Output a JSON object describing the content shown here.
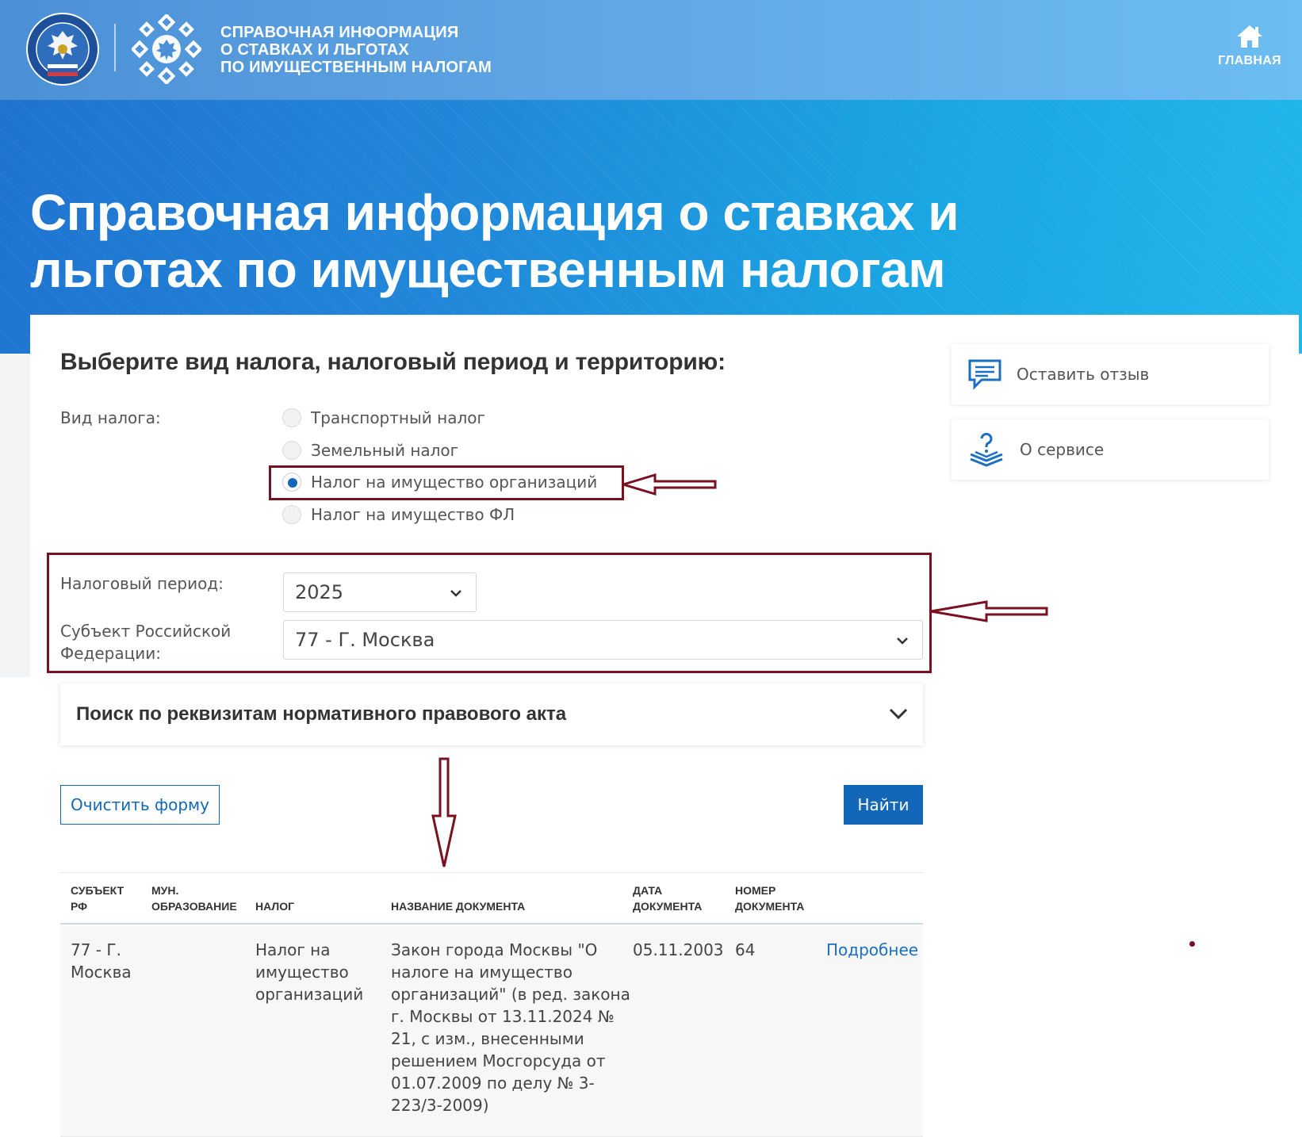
{
  "header": {
    "title_lines": [
      "Справочная информация",
      "о ставках и льготах",
      "по имущественным налогам"
    ],
    "home_label": "ГЛАВНАЯ",
    "icons": {
      "fns_logo": "fns-emblem-icon",
      "service_logo": "service-emblem-icon",
      "home": "home-icon"
    }
  },
  "hero": {
    "title": "Справочная информация о ставках и льготах по имущественным налогам"
  },
  "form": {
    "heading": "Выберите вид налога, налоговый период и территорию:",
    "tax_type_label": "Вид налога:",
    "tax_options": [
      {
        "label": "Транспортный налог",
        "selected": false
      },
      {
        "label": "Земельный налог",
        "selected": false
      },
      {
        "label": "Налог на имущество организаций",
        "selected": true
      },
      {
        "label": "Налог на имущество ФЛ",
        "selected": false
      }
    ],
    "period_label": "Налоговый период:",
    "period_value": "2025",
    "subject_label_line1": "Субъект Российской",
    "subject_label_line2": "Федерации:",
    "subject_value": "77 - Г. Москва",
    "accordion_title": "Поиск по реквизитам нормативного правового акта",
    "clear_button": "Очистить форму",
    "find_button": "Найти"
  },
  "side": {
    "feedback_label": "Оставить отзыв",
    "about_label": "О сервисе"
  },
  "table": {
    "headers": [
      [
        "СУБЪЕКТ",
        "РФ"
      ],
      [
        "МУН.",
        "ОБРАЗОВАНИЕ"
      ],
      [
        "",
        "НАЛОГ"
      ],
      [
        "",
        "НАЗВАНИЕ ДОКУМЕНТА"
      ],
      [
        "ДАТА",
        "ДОКУМЕНТА"
      ],
      [
        "НОМЕР",
        "ДОКУМЕНТА"
      ]
    ],
    "rows": [
      {
        "subject": [
          "77 - Г.",
          "Москва"
        ],
        "municipality": "",
        "tax": [
          "Налог на",
          "имущество",
          "организаций"
        ],
        "document": [
          "Закон города Москвы \"О",
          "налоге на имущество",
          "организаций\" (в ред. закона",
          "г. Москвы от 13.11.2024 №",
          "21, с изм., внесенными",
          "решением Мосгорсуда от",
          "01.07.2009 по делу № 3-",
          "223/3-2009)"
        ],
        "date": "05.11.2003",
        "number": "64",
        "details_link": "Подробнее"
      }
    ]
  },
  "colors": {
    "primary": "#1367b8",
    "annotation": "#7a1020",
    "header_gradient_start": "#4b90d6",
    "hero_gradient_start": "#1f73cf"
  }
}
